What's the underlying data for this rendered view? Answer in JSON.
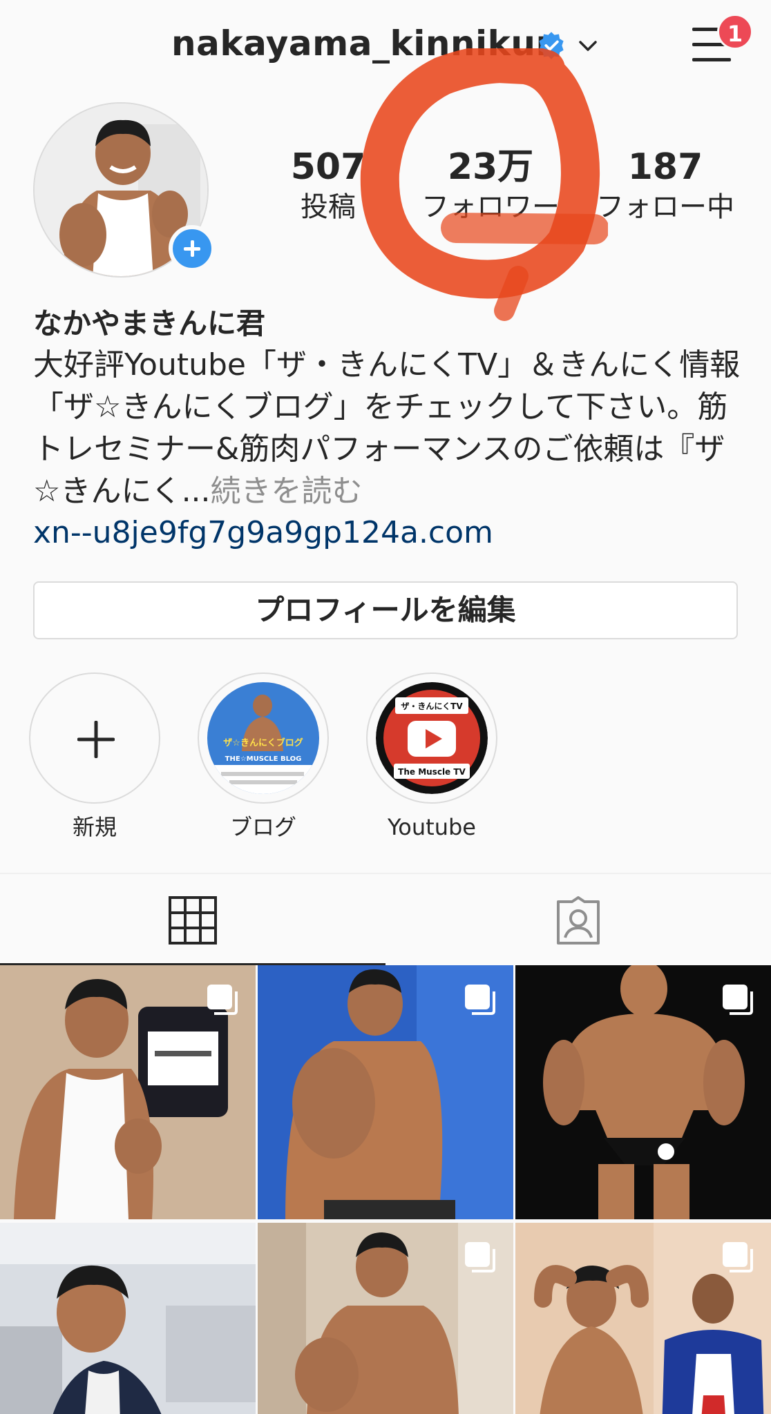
{
  "header": {
    "username": "nakayama_kinnikun",
    "notification_count": "1"
  },
  "stats": [
    {
      "value": "507",
      "label": "投稿"
    },
    {
      "value": "23万",
      "label": "フォロワー"
    },
    {
      "value": "187",
      "label": "フォロー中"
    }
  ],
  "bio": {
    "name": "なかやまきんに君",
    "text": "大好評Youtube「ザ・きんにくTV」＆きんにく情報「ザ☆きんにくブログ」をチェックして下さい。筋トレセミナー&筋肉パフォーマンスのご依頼は『ザ☆きんにく...",
    "more_label": "続きを読む",
    "link": "xn--u8je9fg7g9a9gp124a.com"
  },
  "edit_profile_label": "プロフィールを編集",
  "highlights": [
    {
      "label": "新規"
    },
    {
      "label": "ブログ"
    },
    {
      "label": "Youtube"
    }
  ],
  "highlight_art": {
    "blog_title": "ザ☆きんにくブログ",
    "blog_subtitle": "THE☆MUSCLE BLOG",
    "tv_title": "ザ・きんにくTV",
    "tv_subtitle": "The Muscle TV"
  },
  "colors": {
    "accent_blue": "#3897f0",
    "badge_red": "#ed4956",
    "link_blue": "#003569",
    "annotation_orange": "#e8471c"
  }
}
